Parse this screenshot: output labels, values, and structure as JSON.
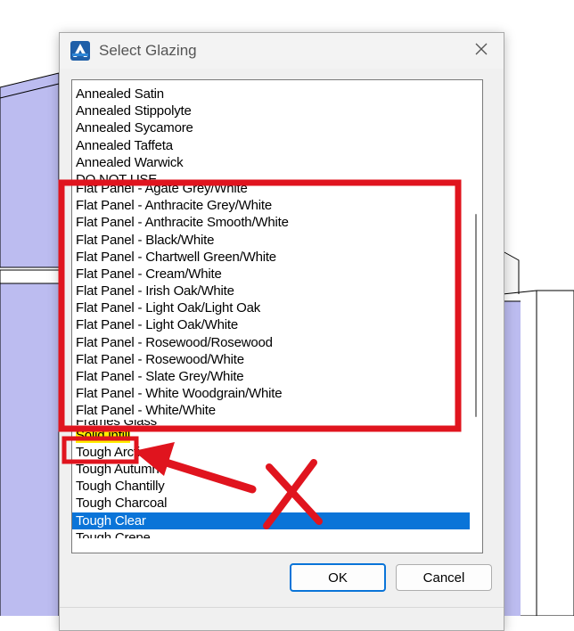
{
  "dialog": {
    "title": "Select Glazing",
    "close_label": "×"
  },
  "list": {
    "items": [
      {
        "label": "Annealed Satin",
        "state": "normal"
      },
      {
        "label": "Annealed Stippolyte",
        "state": "normal"
      },
      {
        "label": "Annealed Sycamore",
        "state": "normal"
      },
      {
        "label": "Annealed Taffeta",
        "state": "normal"
      },
      {
        "label": "Annealed Warwick",
        "state": "normal"
      },
      {
        "label": "DO NOT USE",
        "state": "clipped"
      },
      {
        "label": "Flat Panel - Agate Grey/White",
        "state": "normal"
      },
      {
        "label": "Flat Panel - Anthracite Grey/White",
        "state": "normal"
      },
      {
        "label": "Flat Panel - Anthracite Smooth/White",
        "state": "normal"
      },
      {
        "label": "Flat Panel - Black/White",
        "state": "normal"
      },
      {
        "label": "Flat Panel - Chartwell Green/White",
        "state": "normal"
      },
      {
        "label": "Flat Panel - Cream/White",
        "state": "normal"
      },
      {
        "label": "Flat Panel - Irish Oak/White",
        "state": "normal"
      },
      {
        "label": "Flat Panel - Light Oak/Light Oak",
        "state": "normal"
      },
      {
        "label": "Flat Panel - Light Oak/White",
        "state": "normal"
      },
      {
        "label": "Flat Panel - Rosewood/Rosewood",
        "state": "normal"
      },
      {
        "label": "Flat Panel - Rosewood/White",
        "state": "normal"
      },
      {
        "label": "Flat Panel - Slate Grey/White",
        "state": "normal"
      },
      {
        "label": "Flat Panel - White Woodgrain/White",
        "state": "normal"
      },
      {
        "label": "Flat Panel - White/White",
        "state": "normal"
      },
      {
        "label": "Frames Glass",
        "state": "clipped2"
      },
      {
        "label": "Solid infill",
        "state": "highlighted"
      },
      {
        "label": "Tough Arctic",
        "state": "normal"
      },
      {
        "label": "Tough Autumn",
        "state": "normal"
      },
      {
        "label": "Tough Chantilly",
        "state": "normal"
      },
      {
        "label": "Tough Charcoal",
        "state": "normal"
      },
      {
        "label": "Tough Clear",
        "state": "selected"
      },
      {
        "label": "Tough Crepe",
        "state": "clipped"
      }
    ]
  },
  "buttons": {
    "ok": "OK",
    "cancel": "Cancel"
  },
  "colors": {
    "selection": "#0a74d8",
    "highlight": "#ffee00",
    "annotation": "#e0141e",
    "background_panel": "#bcbcf0"
  },
  "icons": {
    "app": "app-logo-icon",
    "close": "close-icon",
    "annotation_arrow": "arrow-icon",
    "annotation_cross": "cross-mark-icon"
  }
}
